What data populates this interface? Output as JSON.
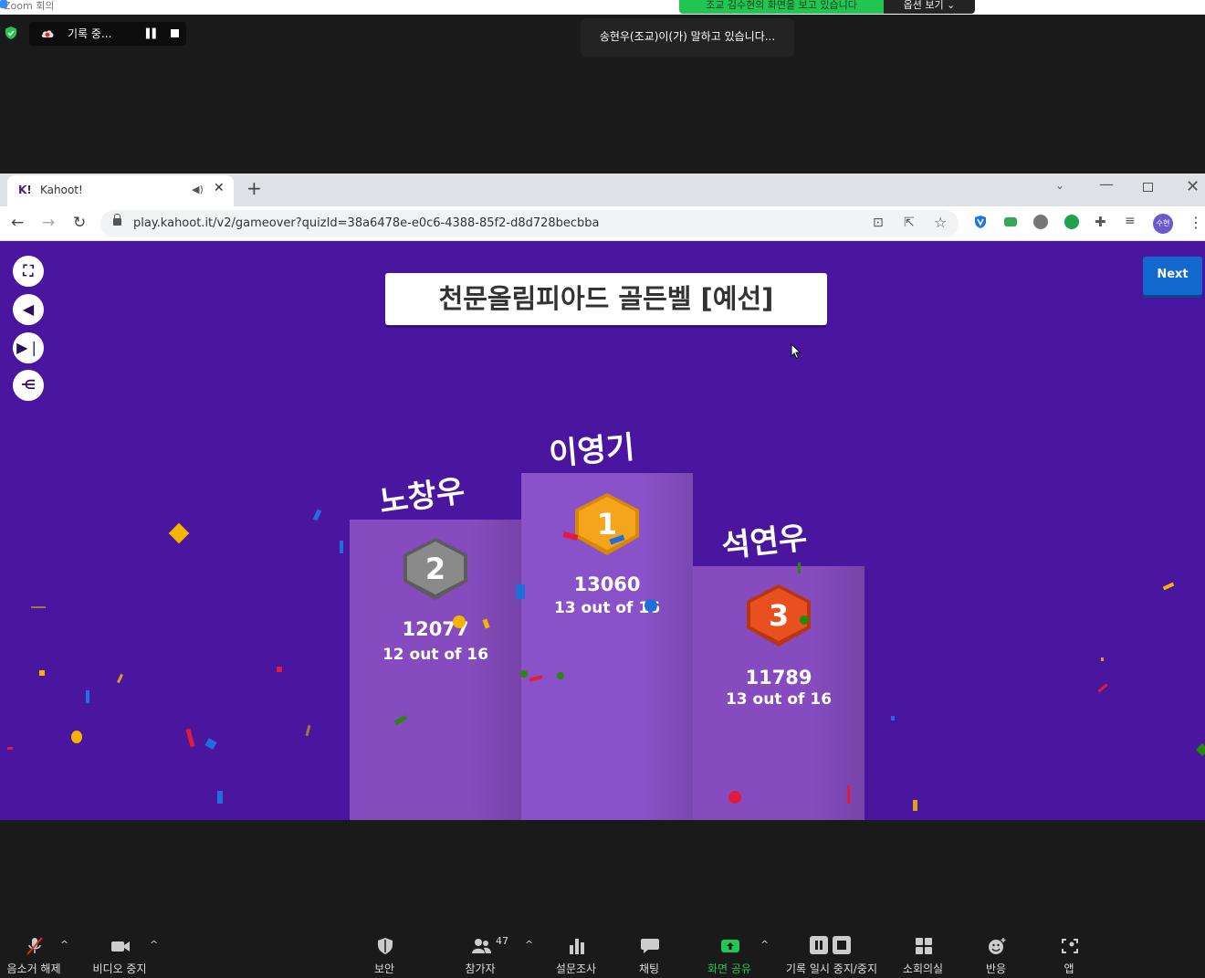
{
  "zoom": {
    "window_title": "Zoom 회의",
    "viewing_banner": "조교 김수현의 화면을 보고 있습니다",
    "view_options": "옵션 보기 ⌄",
    "recording_label": "기록 중...",
    "speaking_toast": "송현우(조교)이(가) 말하고 있습니다...",
    "toolbar": {
      "mute": "음소거 해제",
      "video": "비디오 중지",
      "security": "보안",
      "participants": "참가자",
      "participants_count": "47",
      "polls": "설문조사",
      "chat": "채팅",
      "share": "화면 공유",
      "record": "기록 일시 중지/중지",
      "breakout": "소회의실",
      "reactions": "반응",
      "apps": "앱"
    }
  },
  "browser": {
    "tab_title": "Kahoot!",
    "tab_favicon": "K!",
    "url": "play.kahoot.it/v2/gameover?quizId=38a6478e-e0c6-4388-85f2-d8d728becbba",
    "profile_label": "수현"
  },
  "kahoot": {
    "quiz_title": "천문올림피아드 골든벨 [예선]",
    "next_label": "Next",
    "podium": [
      {
        "rank": "1",
        "name": "이영기",
        "score": "13060",
        "correct": "13 out of 16",
        "medal_color": "#f4a51c"
      },
      {
        "rank": "2",
        "name": "노창우",
        "score": "12077",
        "correct": "12 out of 16",
        "medal_color": "#8a8a8a"
      },
      {
        "rank": "3",
        "name": "석연우",
        "score": "11789",
        "correct": "13 out of 16",
        "medal_color": "#e8501f"
      }
    ],
    "colors": {
      "background": "#4a16a0",
      "podium": "#864cbf",
      "next_button": "#1368ce"
    }
  }
}
